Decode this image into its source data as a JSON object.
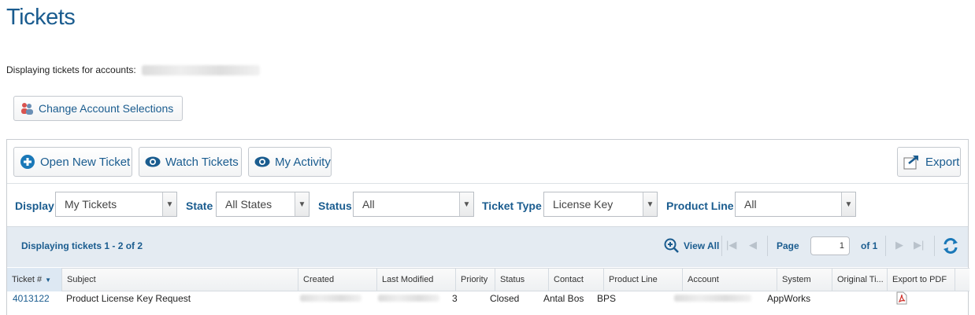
{
  "page": {
    "title": "Tickets",
    "accounts_label": "Displaying tickets for accounts:"
  },
  "buttons": {
    "change_accounts": "Change Account Selections",
    "open_new_ticket": "Open New Ticket",
    "watch_tickets": "Watch Tickets",
    "my_activity": "My Activity",
    "export": "Export"
  },
  "filters": {
    "display": {
      "label": "Display",
      "value": "My Tickets"
    },
    "state": {
      "label": "State",
      "value": "All States"
    },
    "status": {
      "label": "Status",
      "value": "All"
    },
    "ticket_type": {
      "label": "Ticket Type",
      "value": "License Key"
    },
    "product_line": {
      "label": "Product Line",
      "value": "All"
    }
  },
  "pager": {
    "summary": "Displaying tickets 1 - 2 of 2",
    "view_all": "View All",
    "page_label": "Page",
    "page_value": "1",
    "of_label": "of 1"
  },
  "table": {
    "columns": [
      "Ticket #",
      "Subject",
      "Created",
      "Last Modified",
      "Priority",
      "Status",
      "Contact",
      "Product Line",
      "Account",
      "System",
      "Original Ti...",
      "Export to PDF"
    ],
    "rows": [
      {
        "ticket": "4013122",
        "subject": "Product License Key Request",
        "priority": "3",
        "status": "Closed",
        "contact": "Antal Bos",
        "product_line": "BPS",
        "system": "AppWorks"
      }
    ]
  },
  "colors": {
    "accent": "#1a5c8f",
    "pager_bg": "#e4ebf2",
    "pdf_red": "#d0302a"
  }
}
